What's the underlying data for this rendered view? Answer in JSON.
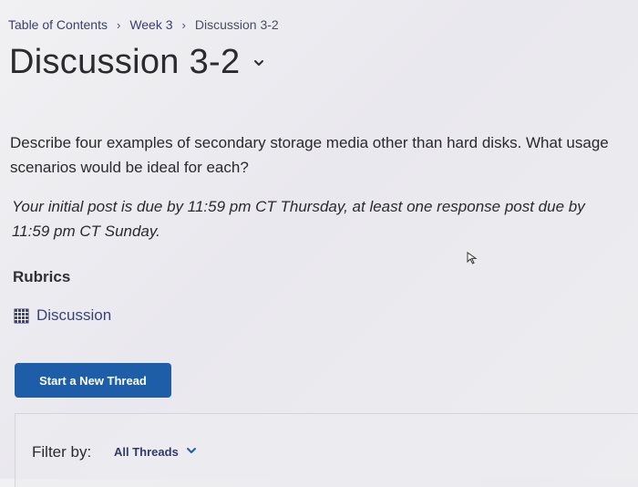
{
  "breadcrumb": {
    "items": [
      "Table of Contents",
      "Week 3"
    ],
    "current": "Discussion 3-2",
    "separator": "›"
  },
  "title": "Discussion 3-2",
  "content": {
    "description": "Describe four examples of secondary storage media other than hard disks. What usage scenarios would be ideal for each?",
    "due_note": "Your initial post is due by 11:59 pm CT Thursday, at least one response post due by 11:59 pm CT Sunday."
  },
  "rubrics": {
    "heading": "Rubrics",
    "link_label": "Discussion"
  },
  "actions": {
    "new_thread_label": "Start a New Thread"
  },
  "filter": {
    "label": "Filter by:",
    "selected": "All Threads"
  },
  "colors": {
    "accent": "#1e5da8",
    "link": "#3d4275"
  },
  "icons": [
    "chevron-down-icon",
    "grid-icon",
    "cursor-icon"
  ]
}
